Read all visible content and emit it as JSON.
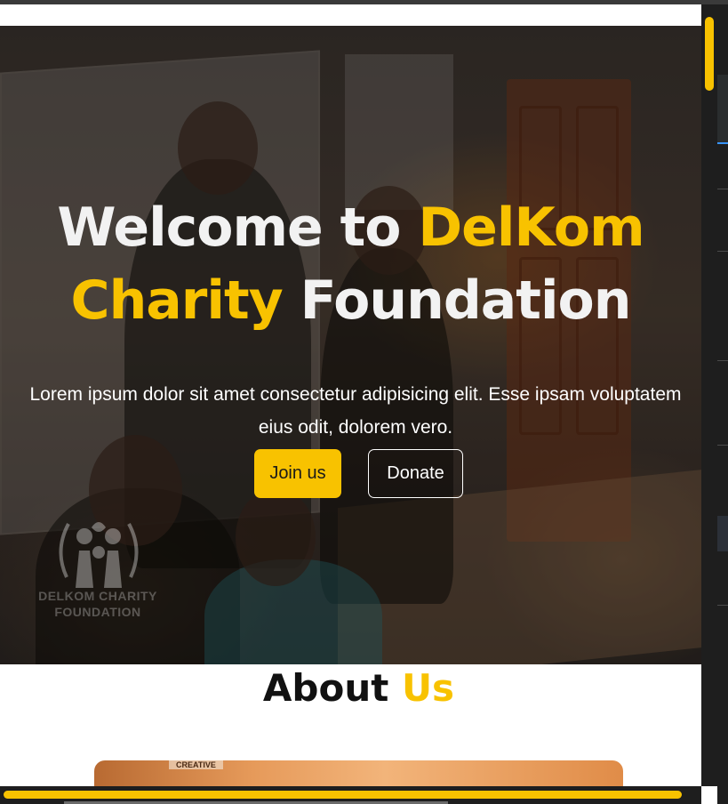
{
  "hero": {
    "title_part1": "Welcome to ",
    "title_accent1": "DelKom",
    "title_accent2": "Charity",
    "title_part2": " Foundation",
    "subtitle": "Lorem ipsum dolor sit amet consectetur adipisicing elit. Esse ipsam voluptatem eius odit, dolorem vero.",
    "join_label": "Join us",
    "donate_label": "Donate",
    "logo_text_line1": "DELKOM CHARITY",
    "logo_text_line2": "FOUNDATION"
  },
  "about": {
    "title_part1": "About ",
    "title_accent": "Us",
    "image_tag": "CREATIVE"
  },
  "colors": {
    "accent": "#f8c200",
    "hero_text": "#f2f2f2",
    "panel": "#1e1e1e"
  },
  "icons": {
    "logo": "charity-people-laurel-icon"
  }
}
